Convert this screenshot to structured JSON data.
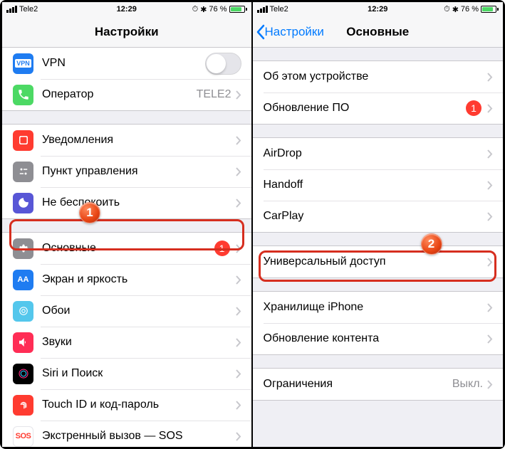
{
  "status": {
    "carrier": "Tele2",
    "time": "12:29",
    "battery_pct": "76 %",
    "alarm": "⏰",
    "bt": "✱"
  },
  "left": {
    "title": "Настройки",
    "rows": {
      "vpn": "VPN",
      "carrier": "Оператор",
      "carrier_detail": "TELE2",
      "notif": "Уведомления",
      "cc": "Пункт управления",
      "dnd": "Не беспокоить",
      "general": "Основные",
      "general_badge": "1",
      "display": "Экран и яркость",
      "wallpaper": "Обои",
      "sounds": "Звуки",
      "siri": "Siri и Поиск",
      "touchid": "Touch ID и код-пароль",
      "sos": "Экстренный вызов — SOS"
    }
  },
  "right": {
    "back": "Настройки",
    "title": "Основные",
    "rows": {
      "about": "Об этом устройстве",
      "update": "Обновление ПО",
      "update_badge": "1",
      "airdrop": "AirDrop",
      "handoff": "Handoff",
      "carplay": "CarPlay",
      "accessibility": "Универсальный доступ",
      "storage": "Хранилище iPhone",
      "refresh": "Обновление контента",
      "restrict": "Ограничения",
      "restrict_detail": "Выкл."
    }
  },
  "annotations": {
    "one": "1",
    "two": "2"
  }
}
